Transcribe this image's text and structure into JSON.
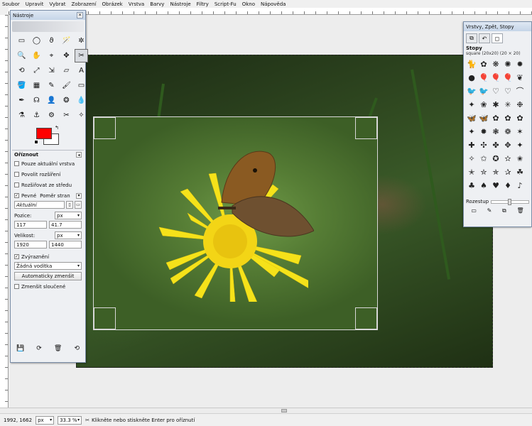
{
  "menubar": {
    "items": [
      "Soubor",
      "Upravit",
      "Vybrat",
      "Zobrazení",
      "Obrázek",
      "Vrstva",
      "Barvy",
      "Nástroje",
      "Filtry",
      "Script-Fu",
      "Okno",
      "Nápověda"
    ]
  },
  "toolbox": {
    "title": "Nástroje",
    "tools": [
      "▭",
      "◯",
      "ϑ",
      "🪄",
      "✲",
      "🔍",
      "✋",
      "⌖",
      "✥",
      "✂",
      "⟲",
      "⤢",
      "⇲",
      "▱",
      "A",
      "🪣",
      "▦",
      "✎",
      "🖌",
      "▭",
      "✒",
      "☊",
      "👤",
      "❂",
      "💧",
      "⚗",
      "⚓",
      "⚙",
      "✂",
      "✧"
    ],
    "fg_color": "#ff0000",
    "options": {
      "title": "Oříznout",
      "current_layer_only": "Pouze aktuální vrstva",
      "allow_growing": "Povolit rozšíření",
      "expand_from_center": "Rozšiřovat ze středu",
      "fixed": "Pevné",
      "fixed_mode": "Poměr stran",
      "fixed_value": "Aktuální",
      "position_label": "Pozice:",
      "position_unit": "px",
      "position_x": "117",
      "position_y": "41.7",
      "size_label": "Velikost:",
      "size_unit": "px",
      "size_w": "1920",
      "size_h": "1440",
      "highlight": "Zvýraznění",
      "guides": "Žádná vodítka",
      "auto_shrink": "Automaticky zmenšit",
      "shrink_merged": "Zmenšit sloučené"
    },
    "footer_icons": [
      "💾",
      "⟳",
      "🗑",
      "⟲"
    ]
  },
  "dock": {
    "title": "Vrstvy, Zpět, Stopy",
    "tabs": [
      "⧉",
      "↶",
      "◻"
    ],
    "brushes_title": "Stopy",
    "brush_name": "square (20x20) (20 × 20)",
    "brushes": [
      "🐈",
      "✿",
      "❋",
      "✺",
      "✹",
      "●",
      "🎈",
      "🎈",
      "🎈",
      "❦",
      "🐦",
      "🐦",
      "♡",
      "♡",
      "⌒",
      "✦",
      "❀",
      "✱",
      "✳",
      "❉",
      "🦋",
      "🦋",
      "✿",
      "✿",
      "✿",
      "✦",
      "✹",
      "❃",
      "❁",
      "✶",
      "✚",
      "✣",
      "✤",
      "✥",
      "✦",
      "✧",
      "✩",
      "✪",
      "✫",
      "✬",
      "✭",
      "✮",
      "✯",
      "✰",
      "☘",
      "♣",
      "♠",
      "♥",
      "♦",
      "♪"
    ],
    "spacing_label": "Rozestup",
    "footer_icons": [
      "▭",
      "✎",
      "⧉",
      "🗑"
    ]
  },
  "status": {
    "coords": "1992, 1662",
    "unit": "px",
    "zoom": "33.3 %",
    "message": "Klikněte nebo stiskněte Enter pro oříznutí"
  }
}
